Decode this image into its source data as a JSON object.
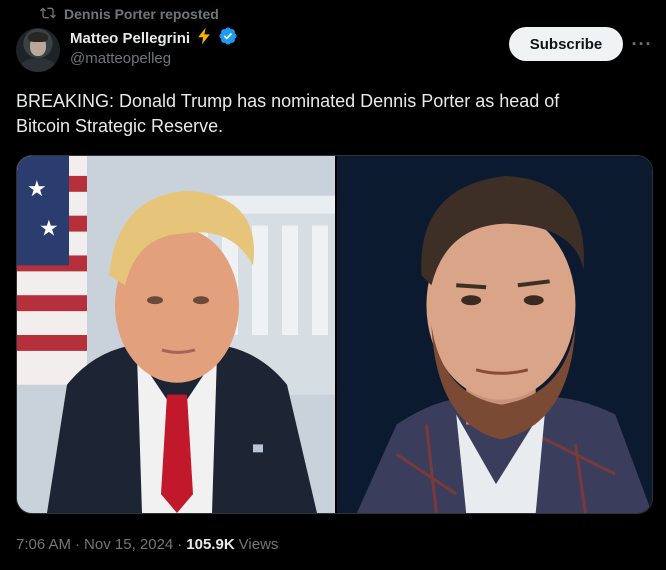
{
  "repost": {
    "label": "Dennis Porter reposted"
  },
  "author": {
    "display_name": "Matteo Pellegrini",
    "badge_emoji": "lightning-icon",
    "handle": "@matteopelleg"
  },
  "actions": {
    "subscribe_label": "Subscribe",
    "more_label": "···"
  },
  "tweet": {
    "text_line1": "BREAKING: Donald Trump has nominated Dennis Porter as head of",
    "text_line2": "Bitcoin Strategic Reserve."
  },
  "media": {
    "left_image": "portrait-man-blond-hair-red-tie-flag-background",
    "right_image": "portrait-man-beard-dark-background"
  },
  "meta": {
    "time": "7:06 AM",
    "sep1": "·",
    "date": "Nov 15, 2024",
    "sep2": "·",
    "views_count": "105.9K",
    "views_label": "Views"
  },
  "colors": {
    "background": "#000000",
    "text": "#e7e9ea",
    "secondary": "#71767b",
    "verified": "#1d9bf0",
    "lightning": "#f5b400"
  }
}
